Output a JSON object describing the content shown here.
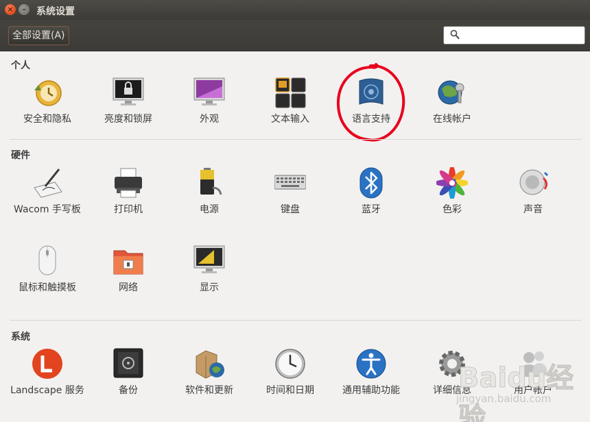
{
  "window": {
    "title": "系统设置"
  },
  "toolbar": {
    "all_settings_label": "全部设置(A)",
    "search_value": ""
  },
  "sections": [
    {
      "title": "个人",
      "items": [
        {
          "label": "安全和隐私",
          "icon": "security-privacy-icon"
        },
        {
          "label": "亮度和锁屏",
          "icon": "brightness-lock-icon"
        },
        {
          "label": "外观",
          "icon": "appearance-icon"
        },
        {
          "label": "文本输入",
          "icon": "text-entry-icon"
        },
        {
          "label": "语言支持",
          "icon": "language-support-icon"
        },
        {
          "label": "在线帐户",
          "icon": "online-accounts-icon"
        }
      ]
    },
    {
      "title": "硬件",
      "items": [
        {
          "label": "Wacom 手写板",
          "icon": "wacom-tablet-icon"
        },
        {
          "label": "打印机",
          "icon": "printer-icon"
        },
        {
          "label": "电源",
          "icon": "power-icon"
        },
        {
          "label": "键盘",
          "icon": "keyboard-icon"
        },
        {
          "label": "蓝牙",
          "icon": "bluetooth-icon"
        },
        {
          "label": "色彩",
          "icon": "color-icon"
        },
        {
          "label": "声音",
          "icon": "sound-icon"
        },
        {
          "label": "鼠标和触摸板",
          "icon": "mouse-touchpad-icon"
        },
        {
          "label": "网络",
          "icon": "network-icon"
        },
        {
          "label": "显示",
          "icon": "display-icon"
        }
      ]
    },
    {
      "title": "系统",
      "items": [
        {
          "label": "Landscape 服务",
          "icon": "landscape-service-icon"
        },
        {
          "label": "备份",
          "icon": "backup-icon"
        },
        {
          "label": "软件和更新",
          "icon": "software-updates-icon"
        },
        {
          "label": "时间和日期",
          "icon": "time-date-icon"
        },
        {
          "label": "通用辅助功能",
          "icon": "universal-access-icon"
        },
        {
          "label": "详细信息",
          "icon": "details-icon"
        },
        {
          "label": "用户帐户",
          "icon": "user-accounts-icon"
        }
      ]
    }
  ],
  "watermark": {
    "brand": "Baidu经验",
    "url": "jingyan.baidu.com"
  },
  "colors": {
    "titlebar": "#3c3b37",
    "background": "#f2f1f0",
    "annotation": "#e8001c",
    "close": "#e4511e"
  }
}
